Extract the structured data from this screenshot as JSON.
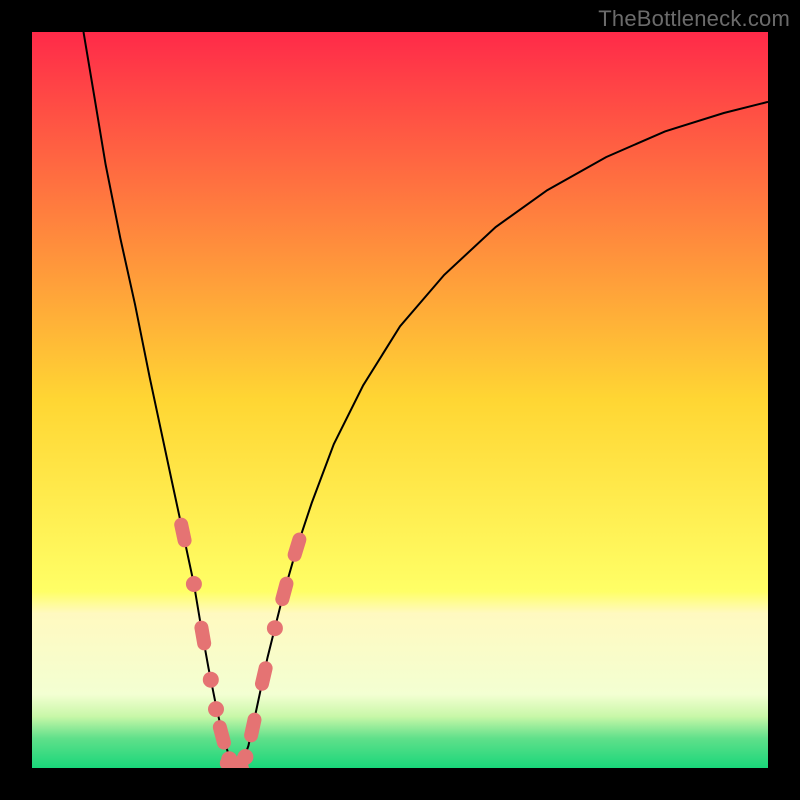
{
  "watermark": "TheBottleneck.com",
  "chart_data": {
    "type": "line",
    "title": "",
    "xlabel": "",
    "ylabel": "",
    "xlim": [
      0,
      100
    ],
    "ylim": [
      0,
      100
    ],
    "grid": false,
    "legend": false,
    "background_gradient": {
      "stops": [
        {
          "offset": 0.0,
          "color": "#ff2a49"
        },
        {
          "offset": 0.5,
          "color": "#ffd633"
        },
        {
          "offset": 0.76,
          "color": "#ffff66"
        },
        {
          "offset": 0.79,
          "color": "#fff9c0"
        },
        {
          "offset": 0.9,
          "color": "#f3ffd2"
        },
        {
          "offset": 0.93,
          "color": "#c8f7a8"
        },
        {
          "offset": 0.96,
          "color": "#5fe08a"
        },
        {
          "offset": 1.0,
          "color": "#19d67a"
        }
      ]
    },
    "series": [
      {
        "name": "bottleneck-curve",
        "color": "#000000",
        "x": [
          7.0,
          8.5,
          10.0,
          12.0,
          14.0,
          16.0,
          17.5,
          19.0,
          20.5,
          22.0,
          23.0,
          24.0,
          25.0,
          26.0,
          27.0,
          27.8,
          28.5,
          29.4,
          30.5,
          32.0,
          34.0,
          36.0,
          38.0,
          41.0,
          45.0,
          50.0,
          56.0,
          63.0,
          70.0,
          78.0,
          86.0,
          94.0,
          100.0
        ],
        "y": [
          100.0,
          91.0,
          82.0,
          72.0,
          63.0,
          53.0,
          46.0,
          39.0,
          32.0,
          25.0,
          19.0,
          13.5,
          8.5,
          4.0,
          1.0,
          0.2,
          0.5,
          3.0,
          8.0,
          15.0,
          23.0,
          30.0,
          36.0,
          44.0,
          52.0,
          60.0,
          67.0,
          73.5,
          78.5,
          83.0,
          86.5,
          89.0,
          90.5
        ]
      }
    ],
    "markers": {
      "name": "highlighted-points",
      "color": "#e57373",
      "style": "rounded-rect-and-circle",
      "points": [
        {
          "x": 20.5,
          "y": 32.0,
          "shape": "pill"
        },
        {
          "x": 22.0,
          "y": 25.0,
          "shape": "circle"
        },
        {
          "x": 23.2,
          "y": 18.0,
          "shape": "pill"
        },
        {
          "x": 24.3,
          "y": 12.0,
          "shape": "circle"
        },
        {
          "x": 25.0,
          "y": 8.0,
          "shape": "circle"
        },
        {
          "x": 25.8,
          "y": 4.5,
          "shape": "pill"
        },
        {
          "x": 26.8,
          "y": 1.2,
          "shape": "circle"
        },
        {
          "x": 27.5,
          "y": 0.3,
          "shape": "pill"
        },
        {
          "x": 28.2,
          "y": 0.3,
          "shape": "pill"
        },
        {
          "x": 29.0,
          "y": 1.5,
          "shape": "circle"
        },
        {
          "x": 30.0,
          "y": 5.5,
          "shape": "pill"
        },
        {
          "x": 31.5,
          "y": 12.5,
          "shape": "pill"
        },
        {
          "x": 33.0,
          "y": 19.0,
          "shape": "circle"
        },
        {
          "x": 34.3,
          "y": 24.0,
          "shape": "pill"
        },
        {
          "x": 36.0,
          "y": 30.0,
          "shape": "pill"
        }
      ]
    }
  }
}
